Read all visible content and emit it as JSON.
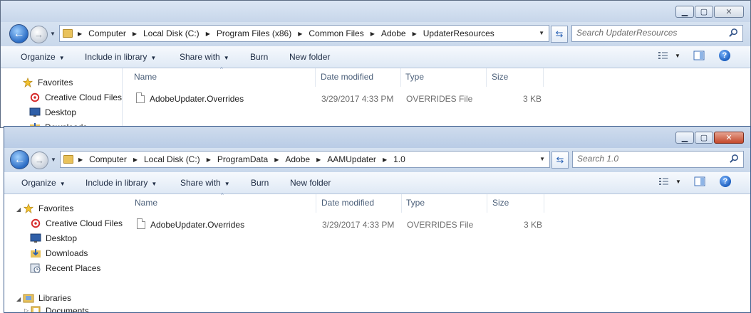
{
  "windows": [
    {
      "address": {
        "crumbs": [
          "Computer",
          "Local Disk (C:)",
          "Program Files (x86)",
          "Common Files",
          "Adobe",
          "UpdaterResources"
        ]
      },
      "search": {
        "placeholder": "Search UpdaterResources"
      },
      "toolbar": {
        "organize": "Organize",
        "include": "Include in library",
        "share": "Share with",
        "burn": "Burn",
        "new_folder": "New folder"
      },
      "nav": [
        {
          "label": "Favorites",
          "icon": "star-icon"
        },
        {
          "label": "Creative Cloud Files",
          "icon": "creative-cloud-icon"
        },
        {
          "label": "Desktop",
          "icon": "desktop-icon"
        },
        {
          "label": "Downloads",
          "icon": "downloads-icon"
        }
      ],
      "columns": [
        "Name",
        "Date modified",
        "Type",
        "Size"
      ],
      "files": [
        {
          "name": "AdobeUpdater.Overrides",
          "date": "3/29/2017 4:33 PM",
          "type": "OVERRIDES File",
          "size": "3 KB"
        }
      ]
    },
    {
      "address": {
        "crumbs": [
          "Computer",
          "Local Disk (C:)",
          "ProgramData",
          "Adobe",
          "AAMUpdater",
          "1.0"
        ]
      },
      "search": {
        "placeholder": "Search 1.0"
      },
      "toolbar": {
        "organize": "Organize",
        "include": "Include in library",
        "share": "Share with",
        "burn": "Burn",
        "new_folder": "New folder"
      },
      "nav": [
        {
          "label": "Favorites",
          "icon": "star-icon"
        },
        {
          "label": "Creative Cloud Files",
          "icon": "creative-cloud-icon"
        },
        {
          "label": "Desktop",
          "icon": "desktop-icon"
        },
        {
          "label": "Downloads",
          "icon": "downloads-icon"
        },
        {
          "label": "Recent Places",
          "icon": "recent-places-icon"
        },
        {
          "label": "Libraries",
          "icon": "libraries-icon"
        },
        {
          "label": "Documents",
          "icon": "documents-icon"
        }
      ],
      "columns": [
        "Name",
        "Date modified",
        "Type",
        "Size"
      ],
      "files": [
        {
          "name": "AdobeUpdater.Overrides",
          "date": "3/29/2017 4:33 PM",
          "type": "OVERRIDES File",
          "size": "3 KB"
        }
      ]
    }
  ],
  "colors": {
    "highlight": "#d9343a",
    "titlebar": "#c7d6ea",
    "toolbar": "#dfe9f5",
    "close_active": "#c4482b"
  }
}
